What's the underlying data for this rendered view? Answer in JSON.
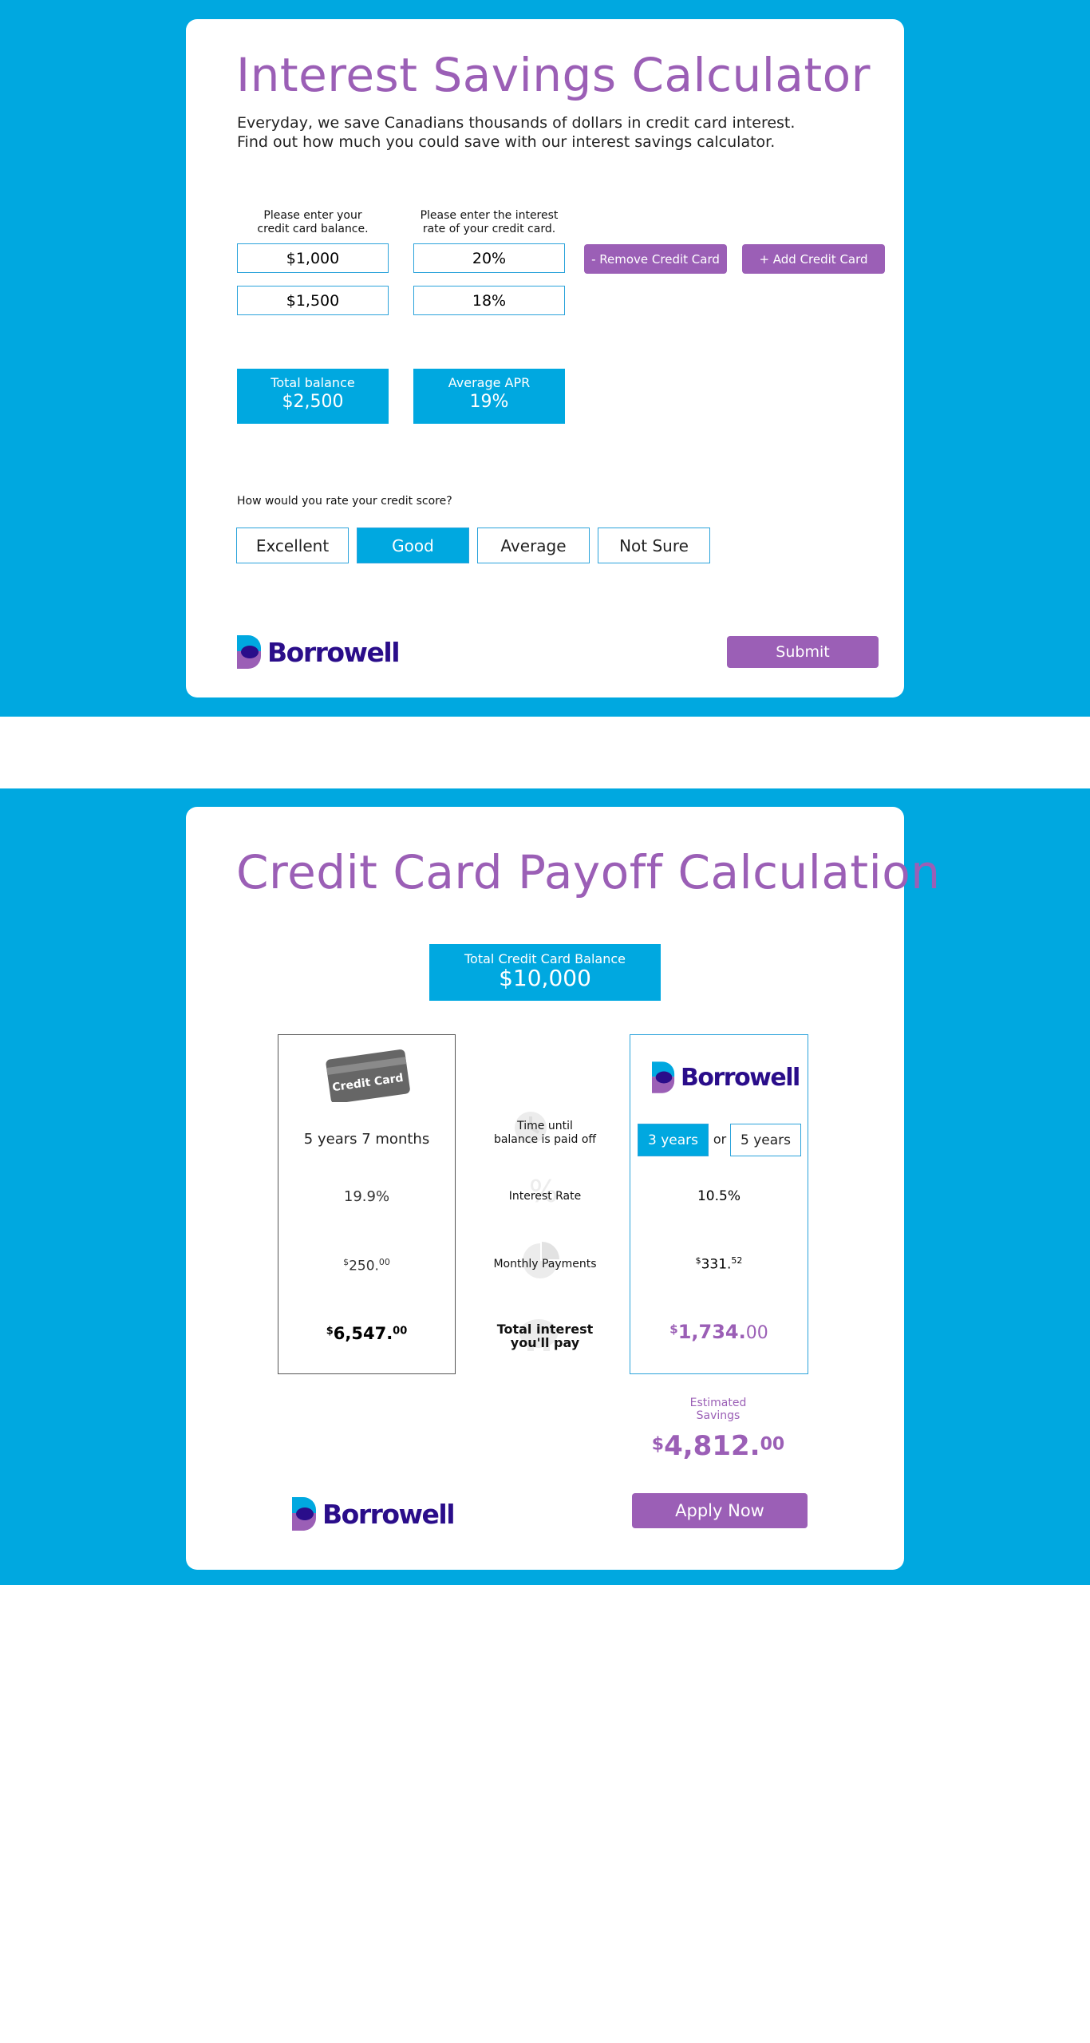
{
  "calculator": {
    "title": "Interest Savings Calculator",
    "intro_line1": "Everyday, we save Canadians thousands of dollars in credit card interest.",
    "intro_line2": "Find out how much you could save with our interest savings calculator.",
    "balance_label_line1": "Please enter your",
    "balance_label_line2": "credit card balance.",
    "rate_label_line1": "Please enter the interest",
    "rate_label_line2": "rate of your credit card.",
    "cards": [
      {
        "balance": "$1,000",
        "rate": "20%"
      },
      {
        "balance": "$1,500",
        "rate": "18%"
      }
    ],
    "remove_button": "- Remove Credit Card",
    "add_button": "+ Add Credit Card",
    "total_balance_label": "Total balance",
    "total_balance_value": "$2,500",
    "average_apr_label": "Average APR",
    "average_apr_value": "19%",
    "credit_question": "How would you rate your credit score?",
    "credit_options": [
      "Excellent",
      "Good",
      "Average",
      "Not Sure"
    ],
    "credit_selected": "Good",
    "submit_button": "Submit"
  },
  "brand": {
    "name": "Borrowell",
    "logo_colors": {
      "blue": "#00a8e0",
      "purple": "#9b5fb6",
      "navy": "#2a0d8a"
    }
  },
  "payoff": {
    "title": "Credit Card Payoff Calculation",
    "total_label": "Total Credit Card Balance",
    "total_value": "$10,000",
    "card_graphic_text": "Credit Card",
    "credit_card": {
      "time": "5 years 7 months",
      "rate": "19.9%",
      "monthly_currency": "$",
      "monthly_main": "250.",
      "monthly_cents": "00",
      "interest_currency": "$",
      "interest_main": "6,547.",
      "interest_cents": "00"
    },
    "rows": {
      "time_line1": "Time until",
      "time_line2": "balance is paid off",
      "rate": "Interest Rate",
      "monthly": "Monthly Payments",
      "interest_line1": "Total interest",
      "interest_line2": "you'll pay"
    },
    "borrowell": {
      "term_options": [
        "3 years",
        "5 years"
      ],
      "term_selected": "3 years",
      "or_text": "or",
      "rate": "10.5%",
      "monthly_currency": "$",
      "monthly_main": "331.",
      "monthly_cents": "52",
      "interest_currency": "$",
      "interest_main": "1,734.",
      "interest_cents": "00"
    },
    "savings_label_line1": "Estimated",
    "savings_label_line2": "Savings",
    "savings_currency": "$",
    "savings_main": "4,812.",
    "savings_cents": "00",
    "apply_button": "Apply Now"
  },
  "colors": {
    "band_blue": "#00a8e0",
    "accent_purple": "#9b5fb6",
    "input_border": "#2ba3db"
  }
}
